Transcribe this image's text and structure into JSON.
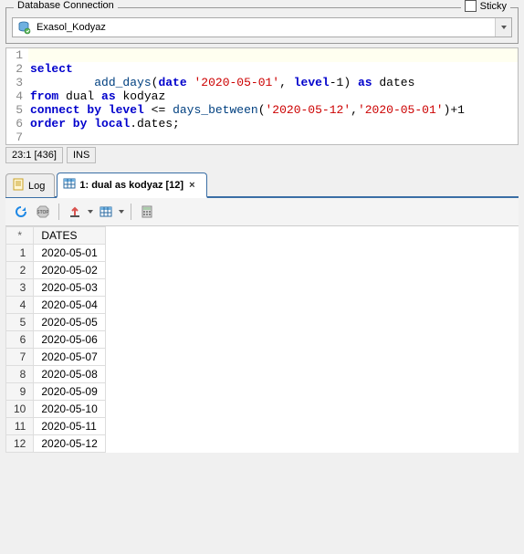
{
  "groupbox": {
    "title": "Database Connection",
    "sticky_label": "Sticky",
    "sticky_checked": false
  },
  "dropdown": {
    "selected": "Exasol_Kodyaz"
  },
  "editor": {
    "lines": [
      {
        "n": 1,
        "tokens": []
      },
      {
        "n": 2,
        "tokens": [
          {
            "t": "select",
            "c": "kw"
          }
        ]
      },
      {
        "n": 3,
        "tokens": [
          {
            "t": "         ",
            "c": ""
          },
          {
            "t": "add_days",
            "c": "fn"
          },
          {
            "t": "(",
            "c": ""
          },
          {
            "t": "date",
            "c": "kw"
          },
          {
            "t": " ",
            "c": ""
          },
          {
            "t": "'2020-05-01'",
            "c": "str"
          },
          {
            "t": ", ",
            "c": ""
          },
          {
            "t": "level",
            "c": "kw"
          },
          {
            "t": "-",
            "c": ""
          },
          {
            "t": "1",
            "c": "num"
          },
          {
            "t": ") ",
            "c": ""
          },
          {
            "t": "as",
            "c": "kw"
          },
          {
            "t": " dates",
            "c": ""
          }
        ]
      },
      {
        "n": 4,
        "tokens": [
          {
            "t": "from",
            "c": "kw"
          },
          {
            "t": " dual ",
            "c": ""
          },
          {
            "t": "as",
            "c": "kw"
          },
          {
            "t": " kodyaz",
            "c": ""
          }
        ]
      },
      {
        "n": 5,
        "tokens": [
          {
            "t": "connect by",
            "c": "kw"
          },
          {
            "t": " ",
            "c": ""
          },
          {
            "t": "level",
            "c": "kw"
          },
          {
            "t": " <= ",
            "c": ""
          },
          {
            "t": "days_between",
            "c": "fn"
          },
          {
            "t": "(",
            "c": ""
          },
          {
            "t": "'2020-05-12'",
            "c": "str"
          },
          {
            "t": ",",
            "c": ""
          },
          {
            "t": "'2020-05-01'",
            "c": "str"
          },
          {
            "t": ")+",
            "c": ""
          },
          {
            "t": "1",
            "c": "num"
          }
        ]
      },
      {
        "n": 6,
        "tokens": [
          {
            "t": "order by",
            "c": "kw"
          },
          {
            "t": " ",
            "c": ""
          },
          {
            "t": "local",
            "c": "kw"
          },
          {
            "t": ".dates;",
            "c": ""
          }
        ]
      },
      {
        "n": 7,
        "tokens": []
      }
    ],
    "highlight_line": 1
  },
  "status": {
    "pos": "23:1 [436]",
    "mode": "INS"
  },
  "tabs": {
    "log_label": "Log",
    "result_label": "1: dual as kodyaz [12]",
    "close_glyph": "×"
  },
  "toolbar_icons": {
    "refresh": "refresh-icon",
    "stop": "stop-icon",
    "export": "export-icon",
    "grid": "grid-icon",
    "calc": "calc-icon"
  },
  "grid": {
    "corner": "*",
    "columns": [
      "DATES"
    ],
    "rows": [
      [
        "2020-05-01"
      ],
      [
        "2020-05-02"
      ],
      [
        "2020-05-03"
      ],
      [
        "2020-05-04"
      ],
      [
        "2020-05-05"
      ],
      [
        "2020-05-06"
      ],
      [
        "2020-05-07"
      ],
      [
        "2020-05-08"
      ],
      [
        "2020-05-09"
      ],
      [
        "2020-05-10"
      ],
      [
        "2020-05-11"
      ],
      [
        "2020-05-12"
      ]
    ]
  }
}
